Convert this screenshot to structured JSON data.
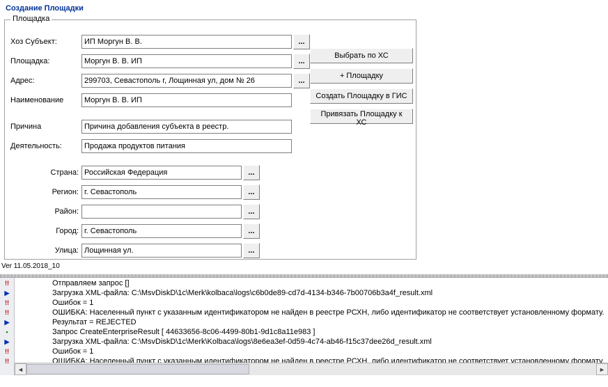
{
  "title": "Создание Площадки",
  "group": {
    "label": "Площадка",
    "rows": {
      "hoz_label": "Хоз Субъект:",
      "hoz_value": "ИП Моргун В. В.",
      "area_label": "Площадка:",
      "area_value": "Моргун В. В. ИП",
      "addr_label": "Адрес:",
      "addr_value": "299703, Севастополь г, Лощинная ул, дом № 26",
      "name_label": "Наименование",
      "name_value": "Моргун В. В. ИП",
      "reason_label": "Причина",
      "reason_value": "Причина добавления субъекта в реестр.",
      "act_label": "Деятельность:",
      "act_value": "Продажа продуктов питания",
      "country_label": "Страна:",
      "country_value": "Российская Федерация",
      "region_label": "Регион:",
      "region_value": "г. Севастополь",
      "district_label": "Район:",
      "district_value": "",
      "city_label": "Город:",
      "city_value": "г. Севастополь",
      "street_label": "Улица:",
      "street_value": "Лощинная ул."
    },
    "lookup_glyph": "..."
  },
  "buttons": {
    "select_by_xc": "Выбрать по ХС",
    "add_area": "+ Площадку",
    "create_gis": "Создать Площадку в ГИС",
    "bind_xc": "Привязать Площадку к ХС"
  },
  "version": "Ver 11.05.2018_10",
  "log": {
    "lines": [
      "Отправляем запрос []",
      "Загрузка XML-файла: C:\\MsvDiskD\\1c\\Merk\\kolbaca\\logs\\c6b0de89-cd7d-4134-b346-7b00706b3a4f_result.xml",
      "Ошибок = 1",
      "ОШИБКА: Населенный пункт с указанным идентификатором не найден в реестре РСХН, либо идентификатор не соответствует установленному формату.",
      "Результат = REJECTED",
      " Запрос CreateEnterpriseResult [ 44633656-8c06-4499-80b1-9d1c8a11e983 ]",
      "Загрузка XML-файла: C:\\MsvDiskD\\1c\\Merk\\Kolbaca\\logs\\8e6ea3ef-0d59-4c74-ab46-f15c37dee26d_result.xml",
      "Ошибок = 1",
      "ОШИБКА: Населенный пункт с указанным идентификатором не найден в реестре РСХН, либо идентификатор не соответствует установленному формату."
    ]
  }
}
